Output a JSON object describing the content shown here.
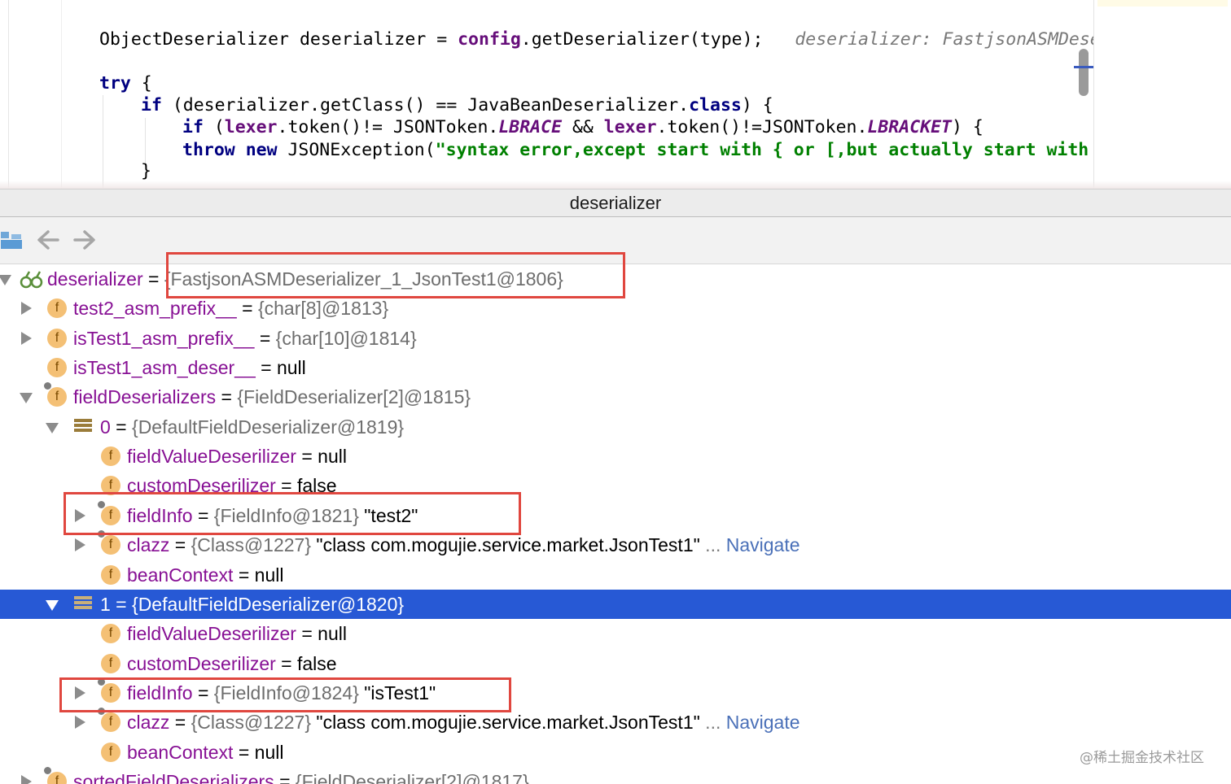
{
  "editor": {
    "line1": {
      "text_a": "ObjectDeserializer deserializer = ",
      "config": "config",
      "text_b": ".getDeserializer(type);",
      "hint": "deserializer: FastjsonASMDeseri"
    },
    "line2": {
      "kw_try": "try",
      "rest": " {"
    },
    "line3": {
      "kw_if": "if",
      "text_a": " (deserializer.getClass() == JavaBeanDeserializer.",
      "kw_class": "class",
      "text_b": ") {"
    },
    "line4": {
      "kw_if": "if",
      "text_a": " (",
      "lexer1": "lexer",
      "text_b": ".token()!= JSONToken.",
      "lbrace": "LBRACE",
      "text_c": " && ",
      "lexer2": "lexer",
      "text_d": ".token()!=JSONToken.",
      "lbracket": "LBRACKET",
      "text_e": ") {"
    },
    "line5": {
      "kw_throw": "throw",
      "kw_new": "new",
      "text_a": " JSONException(",
      "string": "\"syntax error,except start with { or [,but actually start with \""
    },
    "line6": {
      "text": "}"
    }
  },
  "popup": {
    "title": "deserializer"
  },
  "toolbar": {
    "buttons": [
      {
        "icon": "watches-icon"
      },
      {
        "icon": "back-arrow-icon"
      },
      {
        "icon": "forward-arrow-icon"
      }
    ]
  },
  "tree": {
    "rows": [
      {
        "name": "deserializer",
        "eq": " = ",
        "ref": "{FastjsonASMDeserializer_1_JsonTest1@1806}",
        "value": "",
        "icon": "watch-glasses-icon",
        "expanded": true
      },
      {
        "name": "test2_asm_prefix__",
        "eq": " = ",
        "ref": "{char[8]@1813}",
        "value": "",
        "icon": "field-icon",
        "expandable": true
      },
      {
        "name": "isTest1_asm_prefix__",
        "eq": " = ",
        "ref": "{char[10]@1814}",
        "value": "",
        "icon": "field-icon",
        "expandable": true
      },
      {
        "name": "isTest1_asm_deser__",
        "eq": " = ",
        "ref": "",
        "value": "null",
        "icon": "field-icon"
      },
      {
        "name": "fieldDeserializers",
        "eq": " = ",
        "ref": "{FieldDeserializer[2]@1815}",
        "value": "",
        "icon": "field-final-icon",
        "expanded": true
      },
      {
        "name": "0",
        "eq": " = ",
        "ref": "{DefaultFieldDeserializer@1819}",
        "value": "",
        "icon": "array-element-icon",
        "expanded": true
      },
      {
        "name": "fieldValueDeserilizer",
        "eq": " = ",
        "ref": "",
        "value": "null",
        "icon": "field-icon"
      },
      {
        "name": "customDeserilizer",
        "eq": " = ",
        "ref": "",
        "value": "false",
        "icon": "field-icon"
      },
      {
        "name": "fieldInfo",
        "eq": " = ",
        "ref": "{FieldInfo@1821}",
        "value": " \"test2\"",
        "icon": "field-final-icon",
        "expandable": true
      },
      {
        "name": "clazz",
        "eq": " = ",
        "ref": "{Class@1227}",
        "value": " \"class com.mogujie.service.market.JsonTest1\"",
        "dots": " ...",
        "nav": " Navigate",
        "icon": "field-final-icon",
        "expandable": true
      },
      {
        "name": "beanContext",
        "eq": " = ",
        "ref": "",
        "value": "null",
        "icon": "field-icon"
      },
      {
        "name": "1",
        "eq": " = ",
        "ref": "{DefaultFieldDeserializer@1820}",
        "value": "",
        "icon": "array-element-icon",
        "expanded": true,
        "selected": true
      },
      {
        "name": "fieldValueDeserilizer",
        "eq": " = ",
        "ref": "",
        "value": "null",
        "icon": "field-icon"
      },
      {
        "name": "customDeserilizer",
        "eq": " = ",
        "ref": "",
        "value": "false",
        "icon": "field-icon"
      },
      {
        "name": "fieldInfo",
        "eq": " = ",
        "ref": "{FieldInfo@1824}",
        "value": " \"isTest1\"",
        "icon": "field-final-icon",
        "expandable": true
      },
      {
        "name": "clazz",
        "eq": " = ",
        "ref": "{Class@1227}",
        "value": " \"class com.mogujie.service.market.JsonTest1\"",
        "dots": " ...",
        "nav": " Navigate",
        "icon": "field-final-icon",
        "expandable": true
      },
      {
        "name": "beanContext",
        "eq": " = ",
        "ref": "",
        "value": "null",
        "icon": "field-icon"
      },
      {
        "name": "sortedFieldDeserializers",
        "eq": " = ",
        "ref": "{FieldDeserializer[2]@1817}",
        "value": "",
        "icon": "field-final-icon",
        "expandable": true
      }
    ]
  },
  "icon_glyphs": {
    "field": "f"
  },
  "colors": {
    "selection": "#2759d5",
    "highlight_box": "#e0473f",
    "field_name": "#871094",
    "navigate_link": "#4a70b8"
  },
  "watermark": "@稀土掘金技术社区"
}
